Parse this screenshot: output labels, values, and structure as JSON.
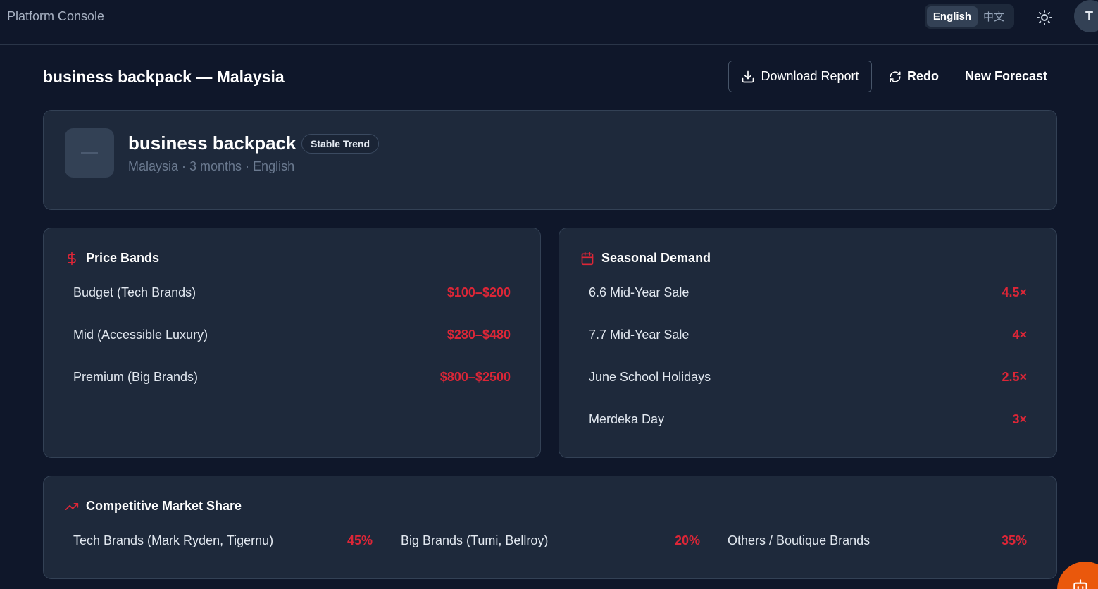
{
  "topbar": {
    "app_title": "Platform Console",
    "languages": [
      "English",
      "中文"
    ],
    "active_language": "English",
    "avatar_initial": "T"
  },
  "header": {
    "title": "business backpack — Malaysia",
    "download_label": "Download Report",
    "redo_label": "Redo",
    "new_forecast_label": "New Forecast"
  },
  "product": {
    "name": "business backpack",
    "trend_badge": "Stable Trend",
    "meta": "Malaysia · 3 months · English"
  },
  "price_bands": {
    "title": "Price Bands",
    "items": [
      {
        "label": "Budget (Tech Brands)",
        "value": "$100–$200"
      },
      {
        "label": "Mid (Accessible Luxury)",
        "value": "$280–$480"
      },
      {
        "label": "Premium (Big Brands)",
        "value": "$800–$2500"
      }
    ]
  },
  "seasonal_demand": {
    "title": "Seasonal Demand",
    "items": [
      {
        "label": "6.6 Mid-Year Sale",
        "value": "4.5×"
      },
      {
        "label": "7.7 Mid-Year Sale",
        "value": "4×"
      },
      {
        "label": "June School Holidays",
        "value": "2.5×"
      },
      {
        "label": "Merdeka Day",
        "value": "3×"
      }
    ]
  },
  "market_share": {
    "title": "Competitive Market Share",
    "items": [
      {
        "label": "Tech Brands (Mark Ryden, Tigernu)",
        "value": "45%"
      },
      {
        "label": "Big Brands (Tumi, Bellroy)",
        "value": "20%"
      },
      {
        "label": "Others / Boutique Brands",
        "value": "35%"
      }
    ]
  },
  "colors": {
    "background": "#0f172a",
    "card": "#1e293b",
    "accent": "#dc2637",
    "fab": "#ea580c"
  },
  "icons": {
    "download": "download-icon",
    "redo": "refresh-icon",
    "theme": "sun-icon",
    "price": "dollar-icon",
    "season": "calendar-icon",
    "share": "trending-up-icon",
    "fab": "bot-icon"
  }
}
